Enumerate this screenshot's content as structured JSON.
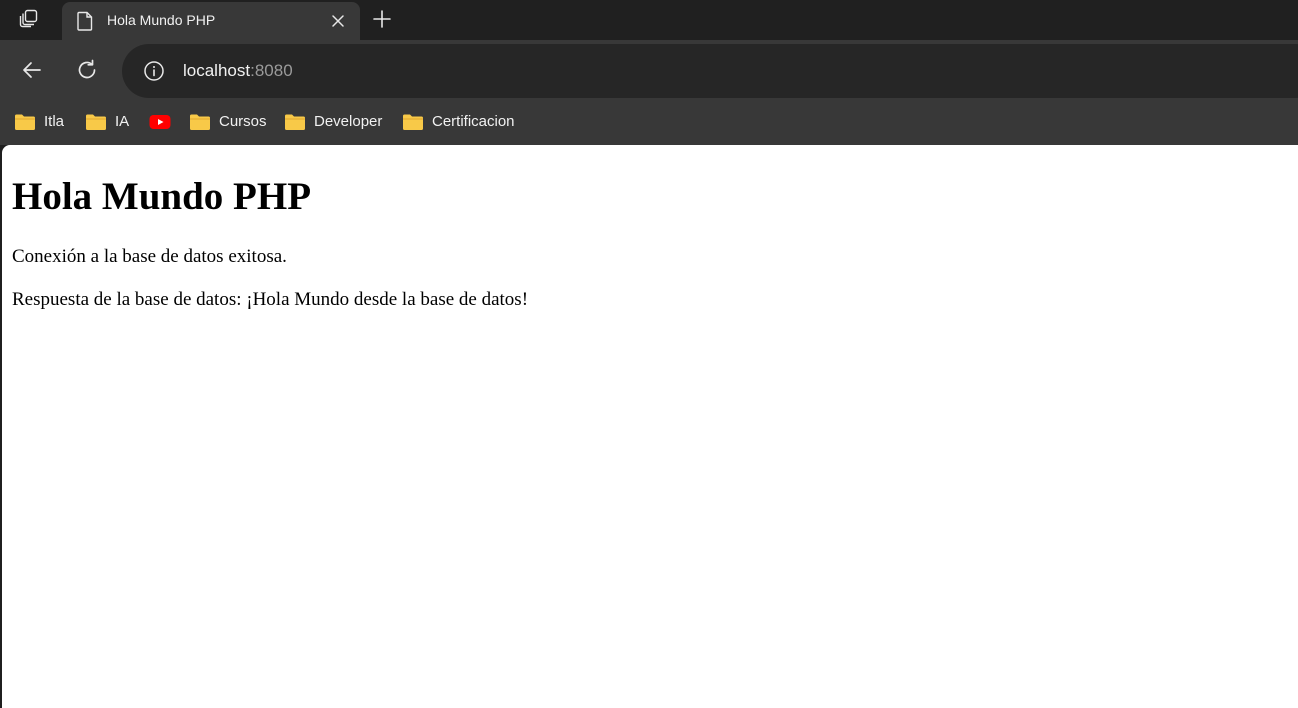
{
  "tab": {
    "title": "Hola Mundo PHP",
    "favicon_icon": "page-icon",
    "close_icon": "close-icon"
  },
  "tabstrip": {
    "tab_actions_icon": "tab-actions-icon",
    "new_tab_icon": "plus-icon"
  },
  "toolbar": {
    "back_icon": "arrow-left-icon",
    "reload_icon": "reload-icon",
    "site_info_icon": "info-icon",
    "url_host": "localhost",
    "url_port": ":8080"
  },
  "bookmarks": {
    "items": [
      {
        "label": "Itla",
        "icon": "folder-icon"
      },
      {
        "label": "IA",
        "icon": "folder-icon"
      },
      {
        "label": "",
        "icon": "youtube-icon"
      },
      {
        "label": "Cursos",
        "icon": "folder-icon"
      },
      {
        "label": "Developer",
        "icon": "folder-icon"
      },
      {
        "label": "Certificacion",
        "icon": "folder-icon"
      }
    ]
  },
  "page": {
    "heading": "Hola Mundo PHP",
    "paragraphs": [
      "Conexión a la base de datos exitosa.",
      "Respuesta de la base de datos: ¡Hola Mundo desde la base de datos!"
    ]
  },
  "colors": {
    "chrome_dark": "#202020",
    "chrome_toolbar": "#383838",
    "omnibox_bg": "#262626",
    "folder_yellow": "#f8c948",
    "youtube_red": "#ff0000",
    "page_bg": "#ffffff"
  }
}
